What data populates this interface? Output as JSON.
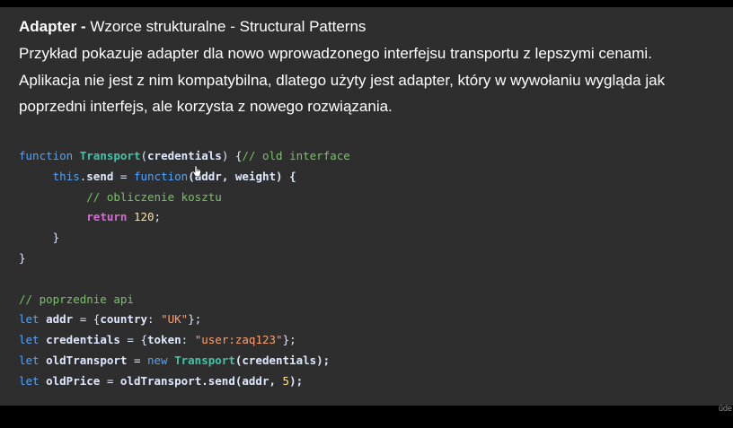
{
  "slide": {
    "title_bold": "Adapter -",
    "title_rest": " Wzorce strukturalne - Structural Patterns",
    "description": [
      "Przykład pokazuje adapter dla nowo wprowadzonego interfejsu transportu z lepszymi cenami.",
      "Aplikacja nie jest z nim kompatybilna, dlatego użyty jest adapter, który w wywołaniu wygląda jak",
      "poprzedni interfejs, ale korzysta z nowego rozwiązania."
    ]
  },
  "code": {
    "l1": {
      "kw": "function",
      "fn": "Transport",
      "open": "(",
      "arg": "credentials",
      "close": ") {",
      "cmt": "// old interface"
    },
    "l2": {
      "this": "this",
      "dot": ".",
      "prop": "send",
      "eq": " = ",
      "kw": "function",
      "args": "(addr, weight) {"
    },
    "l3": {
      "cmt": "// obliczenie kosztu"
    },
    "l4": {
      "ret": "return",
      "num": "120",
      "end": ";"
    },
    "l5": {
      "brace": "}"
    },
    "l6": {
      "brace": "}"
    },
    "l7": {
      "cmt": "// poprzednie api"
    },
    "l8": {
      "kw": "let",
      "name": "addr",
      "eq": " = {",
      "key": "country",
      "colon": ": ",
      "str": "\"UK\"",
      "end": "};"
    },
    "l9": {
      "kw": "let",
      "name": "credentials",
      "eq": " = {",
      "key": "token",
      "colon": ": ",
      "str": "\"user:zaq123\"",
      "end": "};"
    },
    "l10": {
      "kw": "let",
      "name": "oldTransport",
      "eq": " = ",
      "kw2": "new",
      "fn": "Transport",
      "args": "(credentials);"
    },
    "l11": {
      "kw": "let",
      "name": "oldPrice",
      "eq": " = ",
      "call": "oldTransport.send",
      "args": "(addr, ",
      "num": "5",
      "end": ");"
    }
  },
  "watermark": "ûde"
}
